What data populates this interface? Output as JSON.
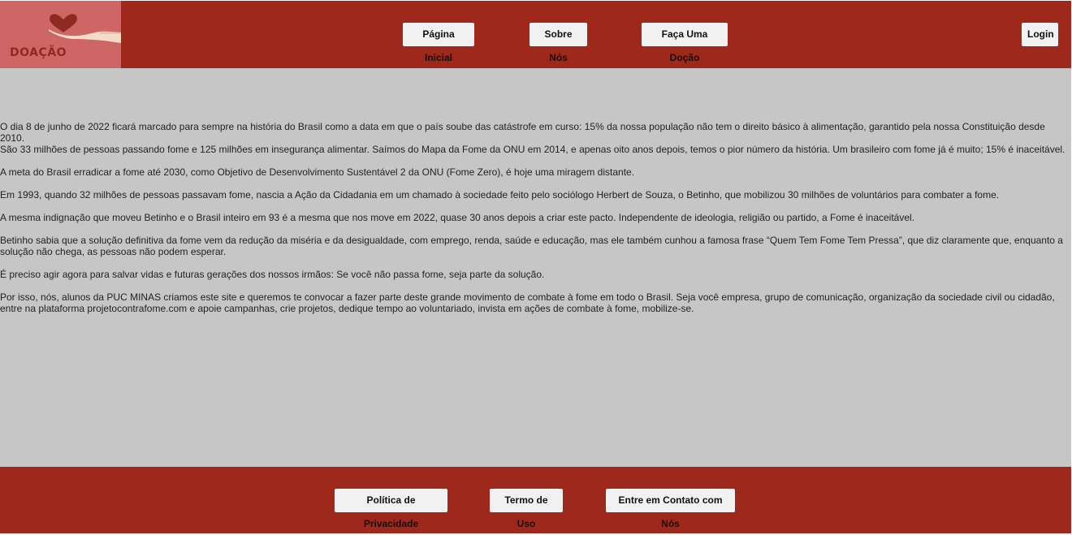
{
  "header": {
    "logo": {
      "text": "DOAÇÃO",
      "icon": "heart-hand-icon",
      "colors": {
        "background": "#cf6666",
        "heart": "#8e2a22",
        "hand": "#f5dcc8"
      }
    },
    "nav": [
      {
        "label": "Página Inicial"
      },
      {
        "label": "Sobre Nós"
      },
      {
        "label": "Faça Uma Doção"
      }
    ],
    "login_label": "Login"
  },
  "main": {
    "paragraphs": [
      "O dia 8 de junho de 2022 ficará marcado para sempre na história do Brasil como a data em que o país soube das catástrofe em curso: 15% da nossa população não tem o direito básico à alimentação, garantido pela nossa Constituição desde 2010.",
      "São 33 milhões de pessoas passando fome e 125 milhões em insegurança alimentar. Saímos do Mapa da Fome da ONU em 2014, e apenas oito anos depois, temos o pior número da história. Um brasileiro com fome já é muito; 15% é inaceitável.",
      "A meta do Brasil erradicar a fome até 2030, como Objetivo de Desenvolvimento Sustentável 2 da ONU (Fome Zero), é hoje uma miragem distante.",
      "Em 1993, quando 32 milhões de pessoas passavam fome, nascia a Ação da Cidadania em um chamado à sociedade feito pelo sociólogo Herbert de Souza, o Betinho, que mobilizou 30 milhões de voluntários para combater a fome.",
      "A mesma indignação que moveu Betinho e o Brasil inteiro em 93 é a mesma que nos move em 2022, quase 30 anos depois a criar este pacto. Independente de ideologia, religião ou partido, a Fome é inaceitável.",
      "Betinho sabia que a solução definitiva da fome vem da redução da miséria e da desigualdade, com emprego, renda, saúde e educação, mas ele também cunhou a famosa frase “Quem Tem Fome Tem Pressa”, que diz claramente que, enquanto a solução não chega, as pessoas não podem esperar.",
      "É preciso agir agora para salvar vidas e futuras gerações dos nossos irmãos: Se você não passa fome, seja parte da solução.",
      "Por isso, nós, alunos da PUC MINAS criamos este site e queremos te convocar a fazer parte deste grande movimento de combate à fome em todo o Brasil. Seja você empresa, grupo de comunicação, organização da sociedade civil ou cidadão, entre na plataforma projetocontrafome.com e apoie campanhas, crie projetos, dedique tempo ao voluntariado, invista em ações de combate à fome, mobilize-se."
    ]
  },
  "footer": {
    "links": [
      {
        "label": "Política de Privacidade"
      },
      {
        "label": "Termo de Uso"
      },
      {
        "label": "Entre em Contato com Nós"
      }
    ]
  },
  "colors": {
    "header_bg": "#9e281b",
    "main_bg": "#c6c6c6",
    "button_bg": "#f1f1f1"
  }
}
